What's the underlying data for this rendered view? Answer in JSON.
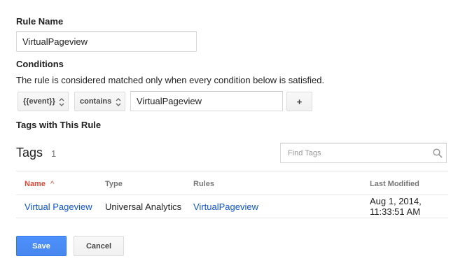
{
  "rule_name": {
    "label": "Rule Name",
    "value": "VirtualPageview"
  },
  "conditions": {
    "label": "Conditions",
    "description": "The rule is considered matched only when every condition below is satisfied.",
    "variable_select": "{{event}}",
    "operator_select": "contains",
    "value": "VirtualPageview",
    "add_label": "+"
  },
  "tags_section": {
    "label": "Tags with This Rule",
    "title": "Tags",
    "count": "1",
    "search_placeholder": "Find Tags",
    "columns": {
      "name": "Name",
      "sort_arrow": "^",
      "type": "Type",
      "rules": "Rules",
      "last_modified": "Last Modified"
    },
    "rows": [
      {
        "name": "Virtual Pageview",
        "type": "Universal Analytics",
        "rules": "VirtualPageview",
        "last_modified_date": "Aug 1, 2014,",
        "last_modified_time": "11:33:51 AM"
      }
    ]
  },
  "actions": {
    "save_label": "Save",
    "cancel_label": "Cancel"
  },
  "colors": {
    "link": "#1155cc",
    "sort_header": "#dd4b39",
    "primary_button": "#4d90fe"
  },
  "icons": {
    "select_arrows": "updown-chevrons-icon",
    "search": "search-icon"
  }
}
